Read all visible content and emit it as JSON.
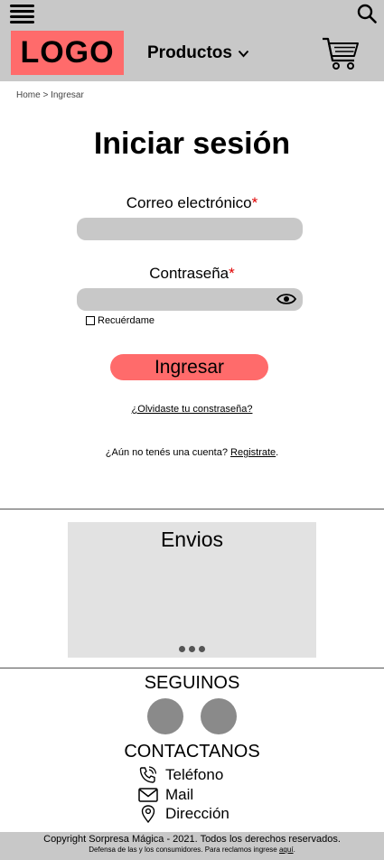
{
  "header": {
    "logo_text": "LOGO",
    "products_label": "Productos"
  },
  "breadcrumb": {
    "home": "Home",
    "separator": ">",
    "current": "Ingresar"
  },
  "login": {
    "title": "Iniciar sesión",
    "email_label": "Correo electrónico",
    "password_label": "Contraseña",
    "required_mark": "*",
    "email_value": "",
    "password_value": "",
    "remember_label": "Recuérdame",
    "submit_label": "Ingresar",
    "forgot_link": "¿Olvidaste tu constraseña?",
    "no_account_text": "¿Aún no tenés una cuenta?",
    "register_link": "Registrate",
    "register_suffix": "."
  },
  "envios": {
    "title": "Envios",
    "slide_count": 3
  },
  "social": {
    "title": "SEGUINOS"
  },
  "contact": {
    "title": "CONTACTANOS",
    "items": [
      {
        "label": "Teléfono",
        "icon": "phone-icon"
      },
      {
        "label": "Mail",
        "icon": "mail-icon"
      },
      {
        "label": "Dirección",
        "icon": "location-pin-icon"
      }
    ]
  },
  "footer": {
    "copyright": "Copyright Sorpresa Mágica - 2021. Todos los derechos reservados.",
    "legal_text": "Defensa de las y los consumidores. Para reclamos ingrese",
    "legal_link": "aquí",
    "legal_suffix": "."
  },
  "colors": {
    "accent": "#ff6b6b",
    "bar_gray": "#c8c8c8",
    "field_gray": "#c8c8c8",
    "panel_gray": "#e2e2e2",
    "required_red": "#e00000"
  },
  "icons": [
    "hamburger-menu-icon",
    "search-icon",
    "chevron-down-icon",
    "shopping-cart-icon",
    "eye-icon",
    "phone-icon",
    "mail-icon",
    "location-pin-icon"
  ]
}
